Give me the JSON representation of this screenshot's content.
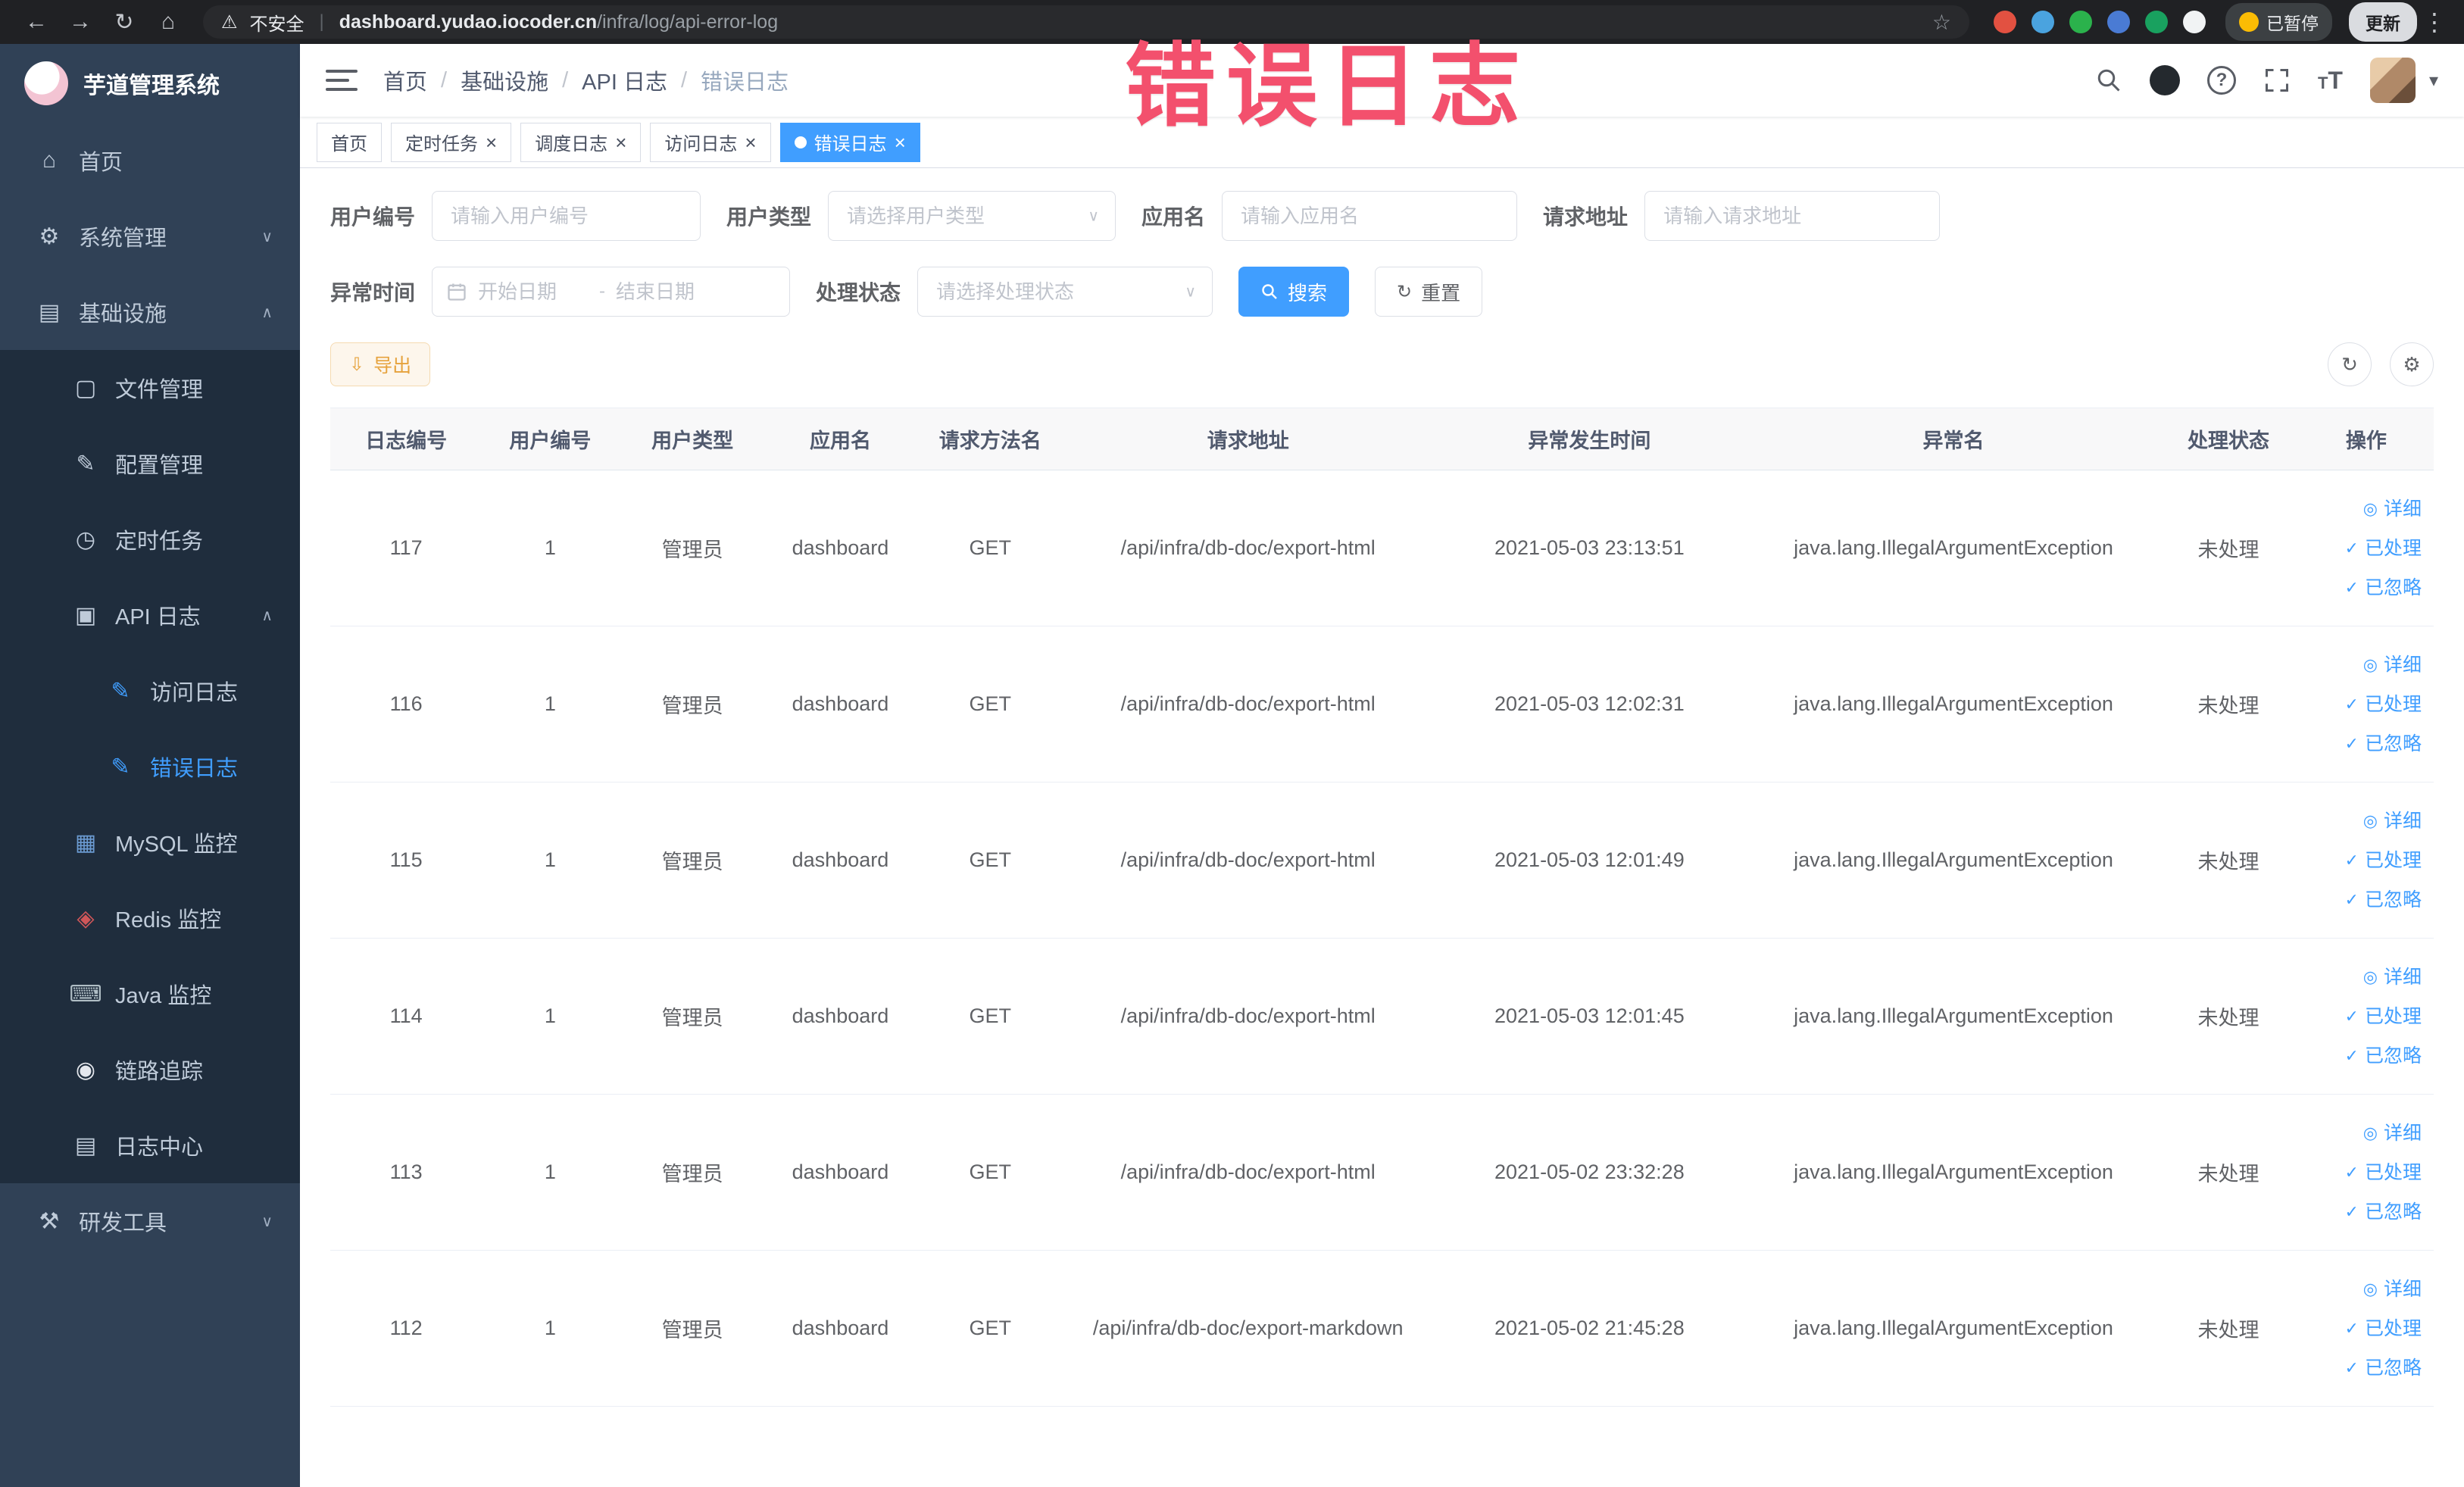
{
  "browser": {
    "security_label": "不安全",
    "url_domain": "dashboard.yudao.iocoder.cn",
    "url_path": "/infra/log/api-error-log",
    "paused_label": "已暂停",
    "update_label": "更新",
    "extension_icons": [
      {
        "name": "extension-icon-red",
        "color": "#e25141"
      },
      {
        "name": "extension-icon-blue-drop",
        "color": "#4aa3df"
      },
      {
        "name": "extension-icon-green-circle",
        "color": "#2bb24c"
      },
      {
        "name": "extension-icon-blue-grid",
        "color": "#4a7bd4"
      },
      {
        "name": "extension-icon-green-badge",
        "color": "#19a15f"
      },
      {
        "name": "extension-icon-light",
        "color": "#f1f3f4"
      }
    ]
  },
  "annotation": {
    "text": "错误日志",
    "color": "#f3506d"
  },
  "sidebar": {
    "logo_title": "芋道管理系统",
    "items": [
      {
        "key": "home",
        "label": "首页",
        "icon": "home-icon",
        "level": 1
      },
      {
        "key": "system",
        "label": "系统管理",
        "icon": "gear-icon",
        "level": 1,
        "arrow": "down"
      },
      {
        "key": "infra",
        "label": "基础设施",
        "icon": "infra-icon",
        "level": 1,
        "arrow": "up"
      },
      {
        "key": "file",
        "label": "文件管理",
        "icon": "file-icon",
        "level": 2
      },
      {
        "key": "config",
        "label": "配置管理",
        "icon": "config-icon",
        "level": 2
      },
      {
        "key": "job",
        "label": "定时任务",
        "icon": "timer-icon",
        "level": 2
      },
      {
        "key": "api-log",
        "label": "API 日志",
        "icon": "api-log-icon",
        "level": 2,
        "arrow": "up"
      },
      {
        "key": "access-log",
        "label": "访问日志",
        "icon": "access-log-icon",
        "level": 3,
        "icon_color": "#409EFF"
      },
      {
        "key": "error-log",
        "label": "错误日志",
        "icon": "error-log-icon",
        "level": 3,
        "icon_color": "#409EFF",
        "active": true
      },
      {
        "key": "mysql",
        "label": "MySQL 监控",
        "icon": "mysql-icon",
        "level": 2,
        "icon_color": "#6b9bd2"
      },
      {
        "key": "redis",
        "label": "Redis 监控",
        "icon": "redis-icon",
        "level": 2,
        "icon_color": "#cf5659"
      },
      {
        "key": "java",
        "label": "Java 监控",
        "icon": "java-icon",
        "level": 2,
        "icon_color": "#b0bec5"
      },
      {
        "key": "trace",
        "label": "链路追踪",
        "icon": "trace-icon",
        "level": 2,
        "icon_color": "#e4e7ed"
      },
      {
        "key": "log-center",
        "label": "日志中心",
        "icon": "log-center-icon",
        "level": 2
      },
      {
        "key": "dev-tools",
        "label": "研发工具",
        "icon": "tools-icon",
        "level": 1,
        "arrow": "down"
      }
    ]
  },
  "header": {
    "breadcrumb": [
      "首页",
      "基础设施",
      "API 日志",
      "错误日志"
    ],
    "separator": "/"
  },
  "tabs": [
    {
      "key": "home",
      "label": "首页",
      "closable": false,
      "active": false
    },
    {
      "key": "job",
      "label": "定时任务",
      "closable": true,
      "active": false
    },
    {
      "key": "job-log",
      "label": "调度日志",
      "closable": true,
      "active": false
    },
    {
      "key": "access-log",
      "label": "访问日志",
      "closable": true,
      "active": false
    },
    {
      "key": "error-log",
      "label": "错误日志",
      "closable": true,
      "active": true
    }
  ],
  "filters": {
    "user_id": {
      "label": "用户编号",
      "placeholder": "请输入用户编号"
    },
    "user_type": {
      "label": "用户类型",
      "placeholder": "请选择用户类型"
    },
    "app_name": {
      "label": "应用名",
      "placeholder": "请输入应用名"
    },
    "request_url": {
      "label": "请求地址",
      "placeholder": "请输入请求地址"
    },
    "exception_time": {
      "label": "异常时间",
      "start_placeholder": "开始日期",
      "separator": "-",
      "end_placeholder": "结束日期"
    },
    "process_status": {
      "label": "处理状态",
      "placeholder": "请选择处理状态"
    },
    "search_label": "搜索",
    "reset_label": "重置"
  },
  "toolbar": {
    "export_label": "导出"
  },
  "table": {
    "columns": [
      "日志编号",
      "用户编号",
      "用户类型",
      "应用名",
      "请求方法名",
      "请求地址",
      "异常发生时间",
      "异常名",
      "处理状态",
      "操作"
    ],
    "row_actions": [
      {
        "label": "详细",
        "icon": "detail-eye-icon"
      },
      {
        "label": "已处理",
        "icon": "check-icon"
      },
      {
        "label": "已忽略",
        "icon": "check-icon"
      }
    ],
    "rows": [
      {
        "id": "117",
        "user_id": "1",
        "user_type": "管理员",
        "app_name": "dashboard",
        "method": "GET",
        "url": "/api/infra/db-doc/export-html",
        "time": "2021-05-03 23:13:51",
        "exception": "java.lang.IllegalArgumentException",
        "status": "未处理"
      },
      {
        "id": "116",
        "user_id": "1",
        "user_type": "管理员",
        "app_name": "dashboard",
        "method": "GET",
        "url": "/api/infra/db-doc/export-html",
        "time": "2021-05-03 12:02:31",
        "exception": "java.lang.IllegalArgumentException",
        "status": "未处理"
      },
      {
        "id": "115",
        "user_id": "1",
        "user_type": "管理员",
        "app_name": "dashboard",
        "method": "GET",
        "url": "/api/infra/db-doc/export-html",
        "time": "2021-05-03 12:01:49",
        "exception": "java.lang.IllegalArgumentException",
        "status": "未处理"
      },
      {
        "id": "114",
        "user_id": "1",
        "user_type": "管理员",
        "app_name": "dashboard",
        "method": "GET",
        "url": "/api/infra/db-doc/export-html",
        "time": "2021-05-03 12:01:45",
        "exception": "java.lang.IllegalArgumentException",
        "status": "未处理"
      },
      {
        "id": "113",
        "user_id": "1",
        "user_type": "管理员",
        "app_name": "dashboard",
        "method": "GET",
        "url": "/api/infra/db-doc/export-html",
        "time": "2021-05-02 23:32:28",
        "exception": "java.lang.IllegalArgumentException",
        "status": "未处理"
      },
      {
        "id": "112",
        "user_id": "1",
        "user_type": "管理员",
        "app_name": "dashboard",
        "method": "GET",
        "url": "/api/infra/db-doc/export-markdown",
        "time": "2021-05-02 21:45:28",
        "exception": "java.lang.IllegalArgumentException",
        "status": "未处理"
      }
    ]
  },
  "colors": {
    "accent": "#409EFF",
    "sidebar_bg": "#304156",
    "submenu_bg": "#1f2d3d",
    "warning_text": "#e6a23c"
  }
}
